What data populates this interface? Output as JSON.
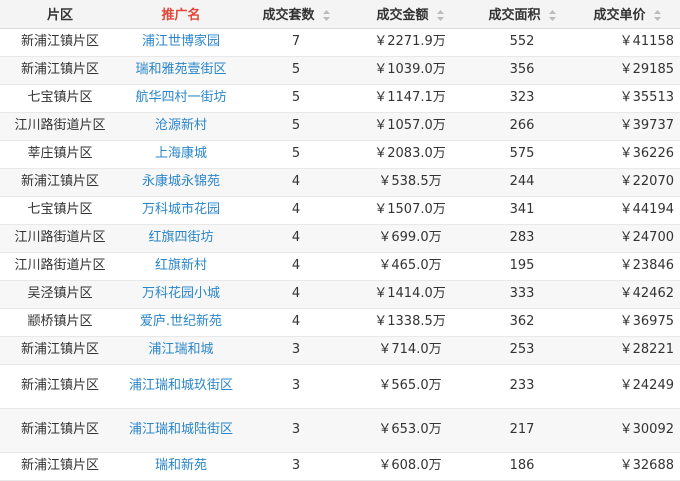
{
  "header": {
    "district": "片区",
    "promo_name": "推广名",
    "deal_count": "成交套数",
    "deal_amount": "成交金额",
    "deal_area": "成交面积",
    "unit_price": "成交单价"
  },
  "colors": {
    "accent_header": "#e0483a",
    "link": "#2a86c9"
  },
  "rows": [
    {
      "district": "新浦江镇片区",
      "name": "浦江世博家园",
      "count": "7",
      "amount": "￥2271.9万",
      "area": "552",
      "price": "￥41158"
    },
    {
      "district": "新浦江镇片区",
      "name": "瑞和雅苑壹街区",
      "count": "5",
      "amount": "￥1039.0万",
      "area": "356",
      "price": "￥29185"
    },
    {
      "district": "七宝镇片区",
      "name": "航华四村一街坊",
      "count": "5",
      "amount": "￥1147.1万",
      "area": "323",
      "price": "￥35513"
    },
    {
      "district": "江川路街道片区",
      "name": "沧源新村",
      "count": "5",
      "amount": "￥1057.0万",
      "area": "266",
      "price": "￥39737"
    },
    {
      "district": "莘庄镇片区",
      "name": "上海康城",
      "count": "5",
      "amount": "￥2083.0万",
      "area": "575",
      "price": "￥36226"
    },
    {
      "district": "新浦江镇片区",
      "name": "永康城永锦苑",
      "count": "4",
      "amount": "￥538.5万",
      "area": "244",
      "price": "￥22070"
    },
    {
      "district": "七宝镇片区",
      "name": "万科城市花园",
      "count": "4",
      "amount": "￥1507.0万",
      "area": "341",
      "price": "￥44194"
    },
    {
      "district": "江川路街道片区",
      "name": "红旗四街坊",
      "count": "4",
      "amount": "￥699.0万",
      "area": "283",
      "price": "￥24700"
    },
    {
      "district": "江川路街道片区",
      "name": "红旗新村",
      "count": "4",
      "amount": "￥465.0万",
      "area": "195",
      "price": "￥23846"
    },
    {
      "district": "吴泾镇片区",
      "name": "万科花园小城",
      "count": "4",
      "amount": "￥1414.0万",
      "area": "333",
      "price": "￥42462"
    },
    {
      "district": "颛桥镇片区",
      "name": "爱庐.世纪新苑",
      "count": "4",
      "amount": "￥1338.5万",
      "area": "362",
      "price": "￥36975"
    },
    {
      "district": "新浦江镇片区",
      "name": "浦江瑞和城",
      "count": "3",
      "amount": "￥714.0万",
      "area": "253",
      "price": "￥28221"
    },
    {
      "district": "新浦江镇片区",
      "name": "浦江瑞和城玖街区",
      "count": "3",
      "amount": "￥565.0万",
      "area": "233",
      "price": "￥24249"
    },
    {
      "district": "新浦江镇片区",
      "name": "浦江瑞和城陆街区",
      "count": "3",
      "amount": "￥653.0万",
      "area": "217",
      "price": "￥30092"
    },
    {
      "district": "新浦江镇片区",
      "name": "瑞和新苑",
      "count": "3",
      "amount": "￥608.0万",
      "area": "186",
      "price": "￥32688"
    }
  ]
}
